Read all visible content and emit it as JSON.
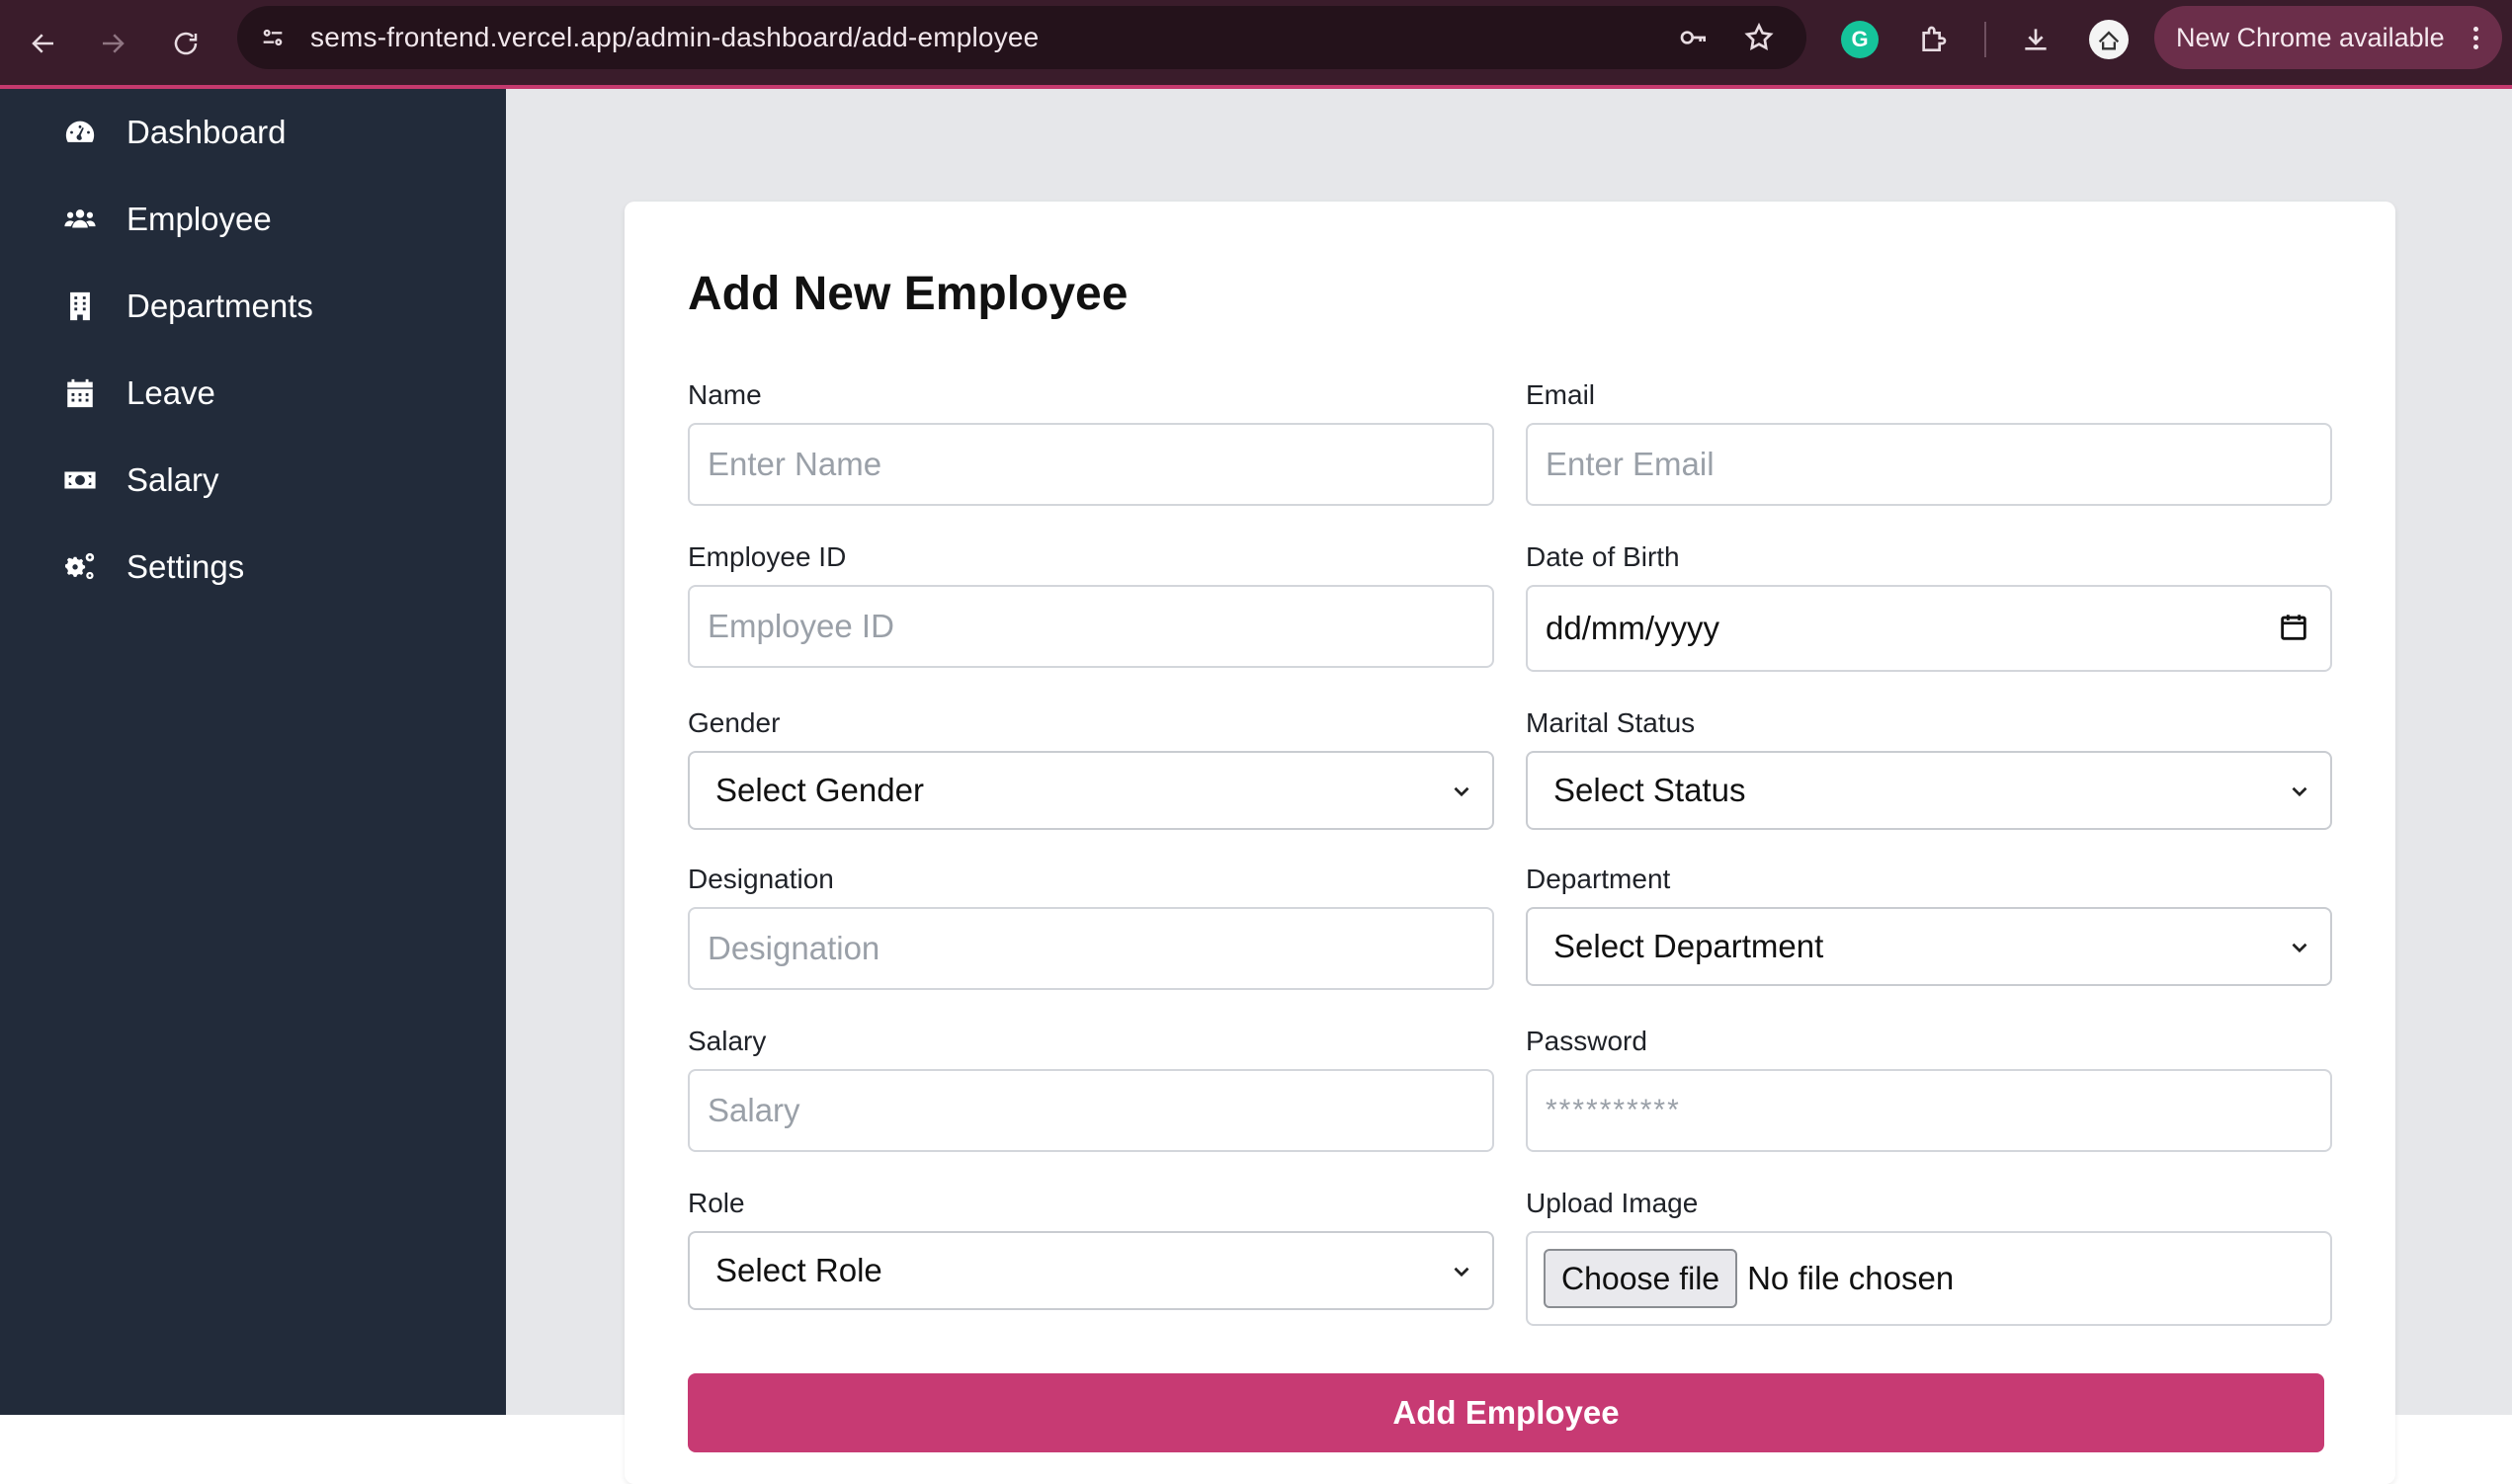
{
  "browser": {
    "url": "sems-frontend.vercel.app/admin-dashboard/add-employee",
    "update_label": "New Chrome available",
    "grammarly_letter": "G"
  },
  "sidebar": {
    "items": [
      {
        "label": "Dashboard",
        "icon": "dashboard-gauge-icon"
      },
      {
        "label": "Employee",
        "icon": "users-icon"
      },
      {
        "label": "Departments",
        "icon": "building-icon"
      },
      {
        "label": "Leave",
        "icon": "calendar-icon"
      },
      {
        "label": "Salary",
        "icon": "money-bill-icon"
      },
      {
        "label": "Settings",
        "icon": "gears-icon"
      }
    ]
  },
  "form": {
    "title": "Add New Employee",
    "name": {
      "label": "Name",
      "placeholder": "Enter Name"
    },
    "email": {
      "label": "Email",
      "placeholder": "Enter Email"
    },
    "employee_id": {
      "label": "Employee ID",
      "placeholder": "Employee ID"
    },
    "dob": {
      "label": "Date of Birth",
      "value": "dd/mm/yyyy"
    },
    "gender": {
      "label": "Gender",
      "selected": "Select Gender"
    },
    "marital_status": {
      "label": "Marital Status",
      "selected": "Select Status"
    },
    "designation": {
      "label": "Designation",
      "placeholder": "Designation"
    },
    "department": {
      "label": "Department",
      "selected": "Select Department"
    },
    "salary": {
      "label": "Salary",
      "placeholder": "Salary"
    },
    "password": {
      "label": "Password",
      "placeholder": "**********"
    },
    "role": {
      "label": "Role",
      "selected": "Select Role"
    },
    "upload_image": {
      "label": "Upload Image",
      "button": "Choose file",
      "status": "No file chosen"
    },
    "submit_label": "Add Employee"
  },
  "colors": {
    "sidebar_bg": "#222b3a",
    "main_bg": "#e6e7ea",
    "accent": "#c73a73",
    "chrome_bg": "#3a1c2b"
  }
}
